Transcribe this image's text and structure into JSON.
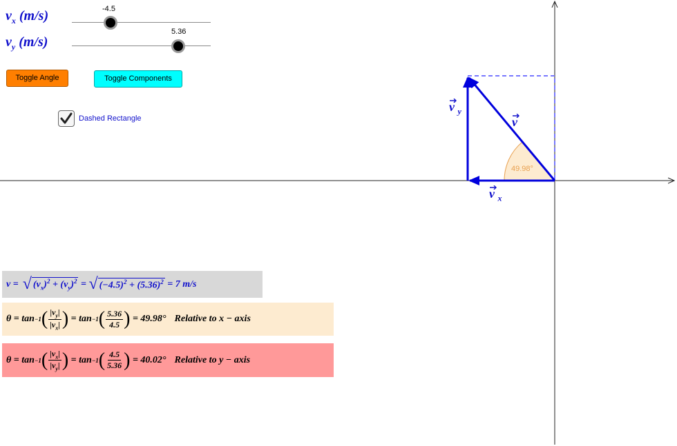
{
  "sliders": {
    "vx": {
      "label": "v",
      "sub": "x",
      "unit": " (m/s)",
      "value": "-4.5"
    },
    "vy": {
      "label": "v",
      "sub": "y",
      "unit": " (m/s)",
      "value": "5.36"
    }
  },
  "buttons": {
    "toggle_angle": "Toggle Angle",
    "toggle_components": "Toggle Components"
  },
  "checkbox": {
    "label": "Dashed Rectangle",
    "checked": true
  },
  "graph": {
    "vector_label": "v",
    "vx_label": "v",
    "vx_sub": "x",
    "vy_label": "v",
    "vy_sub": "y",
    "angle_label": "49.98°"
  },
  "formulas": {
    "magnitude": {
      "lhs": "v =",
      "t1": "(v",
      "t1_sub": "x",
      "t1_close": ")",
      "sq": "2",
      "plus": " + ",
      "t2": "(v",
      "t2_sub": "y",
      "t2_close": ")",
      "eq": " = ",
      "n1": "(−4.5)",
      "n2": "(5.36)",
      "result": " = 7 m/s"
    },
    "theta_x": {
      "lhs": "θ = tan",
      "sup": "−1",
      "num_sym": "|v",
      "num_sub": "y",
      "num_close": "|",
      "den_sym": "|v",
      "den_sub": "x",
      "den_close": "|",
      "eq": " = tan",
      "num_val": "5.36",
      "den_val": "4.5",
      "result": " = 49.98°",
      "note": "Relative to x − axis"
    },
    "theta_y": {
      "lhs": "θ = tan",
      "sup": "−1",
      "num_sym": "|v",
      "num_sub": "x",
      "num_close": "|",
      "den_sym": "|v",
      "den_sub": "y",
      "den_close": "|",
      "eq": " = tan",
      "num_val": "4.5",
      "den_val": "5.36",
      "result": " = 40.02°",
      "note": "Relative to y − axis"
    }
  }
}
